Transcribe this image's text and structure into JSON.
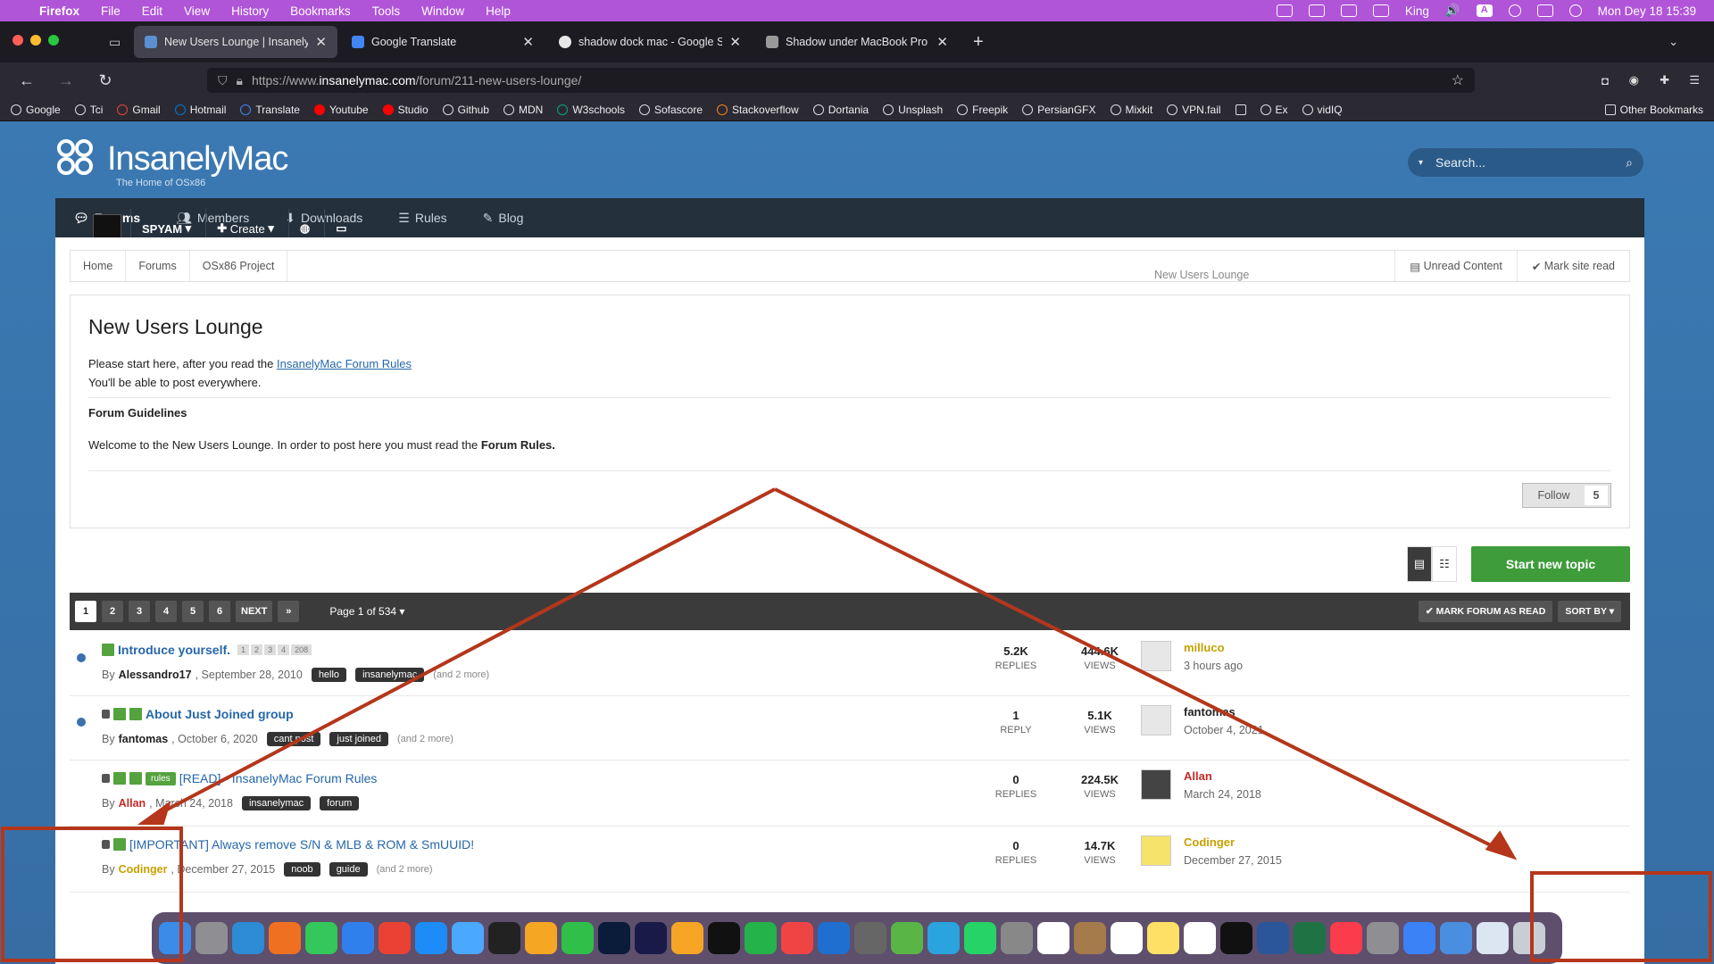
{
  "menubar": {
    "app": "Firefox",
    "items": [
      "File",
      "Edit",
      "View",
      "History",
      "Bookmarks",
      "Tools",
      "Window",
      "Help"
    ],
    "user": "King",
    "input_indicator": "A",
    "datetime": "Mon Dey 18  15:39"
  },
  "tabs": [
    {
      "title": "New Users Lounge | InsanelyMac",
      "active": true,
      "color": "#5b8fd1"
    },
    {
      "title": "Google Translate",
      "active": false,
      "color": "#4285f4"
    },
    {
      "title": "shadow dock mac - Google Search",
      "active": false,
      "color": "#e6e6e6"
    },
    {
      "title": "Shadow under MacBook Pro dock",
      "active": false,
      "color": "#999999"
    }
  ],
  "url": {
    "prefix": "https://www.",
    "domain": "insanelymac.com",
    "path": "/forum/211-new-users-lounge/"
  },
  "bookmarks": [
    "Google",
    "Tci",
    "Gmail",
    "Hotmail",
    "Translate",
    "Youtube",
    "Studio",
    "Github",
    "MDN",
    "W3schools",
    "Sofascore",
    "Stackoverflow",
    "Dortania",
    "Unsplash",
    "Freepik",
    "PersianGFX",
    "Mixkit",
    "VPN.fail",
    "",
    "Ex",
    "vidIQ"
  ],
  "other_bookmarks": "Other Bookmarks",
  "site": {
    "name": "InsanelyMac",
    "tagline": "The Home of OSx86",
    "search_placeholder": "Search..."
  },
  "nav": {
    "items": [
      "Forums",
      "Members",
      "Downloads",
      "Rules",
      "Blog"
    ],
    "user": "SPYAM",
    "create": "Create"
  },
  "breadcrumb": [
    "Home",
    "Forums",
    "OSx86 Project",
    "New Users Lounge"
  ],
  "breadcrumb_actions": [
    "Unread Content",
    "Mark site read"
  ],
  "forum": {
    "title": "New Users Lounge",
    "intro": "Please start here, after you read the ",
    "intro_link": "InsanelyMac Forum Rules",
    "intro2": "You'll be able to post everywhere.",
    "guidelines_title": "Forum Guidelines",
    "welcome_pre": "Welcome to the New Users Lounge. In order to post here you must read the ",
    "welcome_bold": "Forum Rules.",
    "follow_label": "Follow",
    "follow_count": "5"
  },
  "start_topic": "Start new topic",
  "pagination": {
    "pages": [
      "1",
      "2",
      "3",
      "4",
      "5",
      "6"
    ],
    "next": "NEXT",
    "last": "»",
    "info": "Page 1 of 534",
    "mark_read": "MARK FORUM AS READ",
    "sort": "SORT BY"
  },
  "topics": [
    {
      "title": "Introduce yourself.",
      "by": "By",
      "author": "Alessandro17",
      "date": ", September 28, 2010",
      "tags": [
        "hello",
        "insanelymac"
      ],
      "more": "(and 2 more)",
      "mini_pages": [
        "1",
        "2",
        "3",
        "4",
        "208"
      ],
      "replies": "5.2K",
      "replies_label": "REPLIES",
      "views": "444.6K",
      "views_label": "VIEWS",
      "last_user": "milluco",
      "last_time": "3 hours ago"
    },
    {
      "title": "About Just Joined group",
      "by": "By",
      "author": "fantomas",
      "date": ", October 6, 2020",
      "tags": [
        "cant post",
        "just joined"
      ],
      "more": "(and 2 more)",
      "replies": "1",
      "replies_label": "REPLY",
      "views": "5.1K",
      "views_label": "VIEWS",
      "last_user": "fantomas",
      "last_time": "October 4, 2021"
    },
    {
      "title": "[READ] - InsanelyMac Forum Rules",
      "badge": "rules",
      "by": "By",
      "author": "Allan",
      "date": ", March 24, 2018",
      "tags": [
        "insanelymac",
        "forum"
      ],
      "replies": "0",
      "replies_label": "REPLIES",
      "views": "224.5K",
      "views_label": "VIEWS",
      "last_user": "Allan",
      "last_time": "March 24, 2018"
    },
    {
      "title": "[IMPORTANT] Always remove S/N & MLB & ROM & SmUUID!",
      "by": "By",
      "author": "Codinger",
      "date": ", December 27, 2015",
      "tags": [
        "noob",
        "guide"
      ],
      "more": "(and 2 more)",
      "replies": "0",
      "replies_label": "REPLIES",
      "views": "14.7K",
      "views_label": "VIEWS",
      "last_user": "Codinger",
      "last_time": "December 27, 2015"
    }
  ],
  "annotation_color": "#b5361b",
  "dock_icons": [
    "finder",
    "launchpad",
    "safari",
    "firefox",
    "messages",
    "mail",
    "chrome",
    "app-store",
    "xcode-instruments",
    "terminal",
    "photos",
    "facetime",
    "photoshop",
    "after-effects",
    "pages",
    "v2",
    "numbers",
    "anydesk",
    "vscode",
    "screenshot",
    "sourcetree",
    "telegram",
    "whatsapp",
    "silverback",
    "calendar",
    "clutter",
    "reminders",
    "notes",
    "freeform",
    "apple-tv",
    "word",
    "excel",
    "music",
    "system-settings",
    "spark",
    "xcode",
    "downloads",
    "trash"
  ],
  "dock_colors": [
    "#3b8be8",
    "#8e8e93",
    "#2e8bd6",
    "#f07022",
    "#34c759",
    "#2f80ed",
    "#e94235",
    "#1d8cf8",
    "#4aa8ff",
    "#222222",
    "#f5a623",
    "#30c04a",
    "#0b1b3a",
    "#1a1a48",
    "#f6a524",
    "#111111",
    "#24b24a",
    "#ef4444",
    "#1e6fcf",
    "#666666",
    "#5ab547",
    "#2aa3de",
    "#25d366",
    "#888888",
    "#ffffff",
    "#a57b4b",
    "#ffffff",
    "#ffe066",
    "#ffffff",
    "#111111",
    "#2b579a",
    "#1f7244",
    "#fa3c4c",
    "#8e8e93",
    "#3b82f6",
    "#4a8ee0",
    "#dbe6f2",
    "#c9ced6"
  ]
}
